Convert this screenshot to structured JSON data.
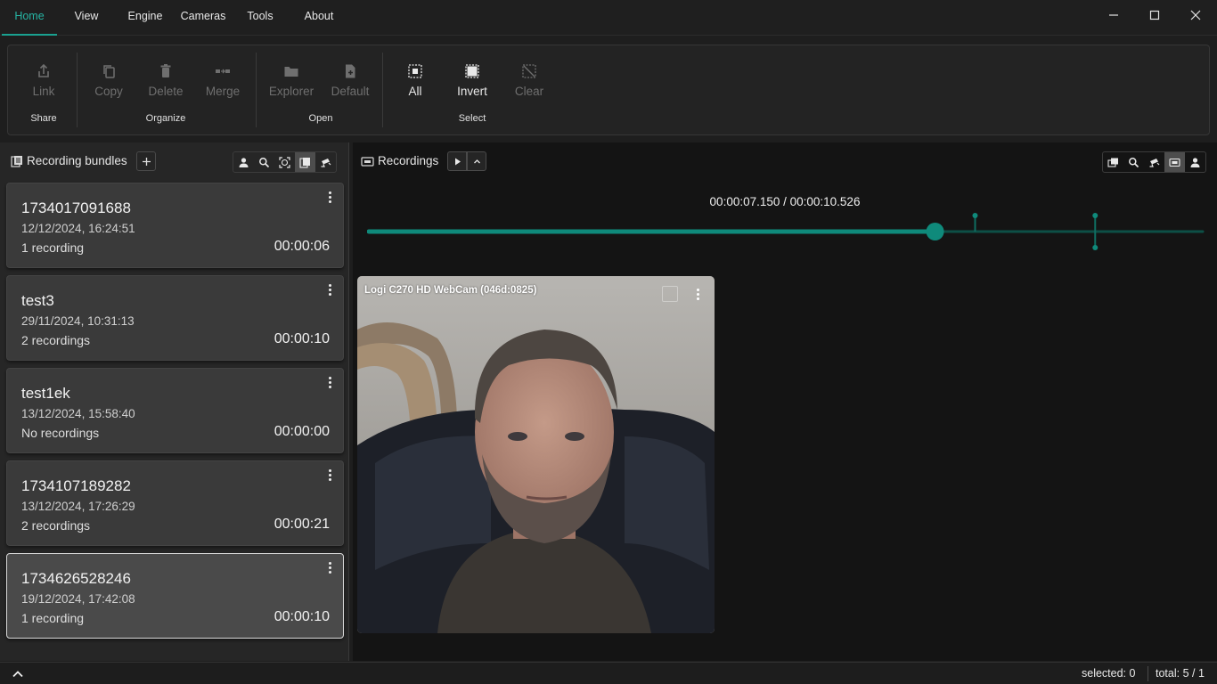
{
  "menu": {
    "items": [
      "Home",
      "View",
      "Engine",
      "Cameras",
      "Tools",
      "About"
    ],
    "active": "Home"
  },
  "window_controls": {
    "minimize": "—",
    "maximize": "☐",
    "close": "✕"
  },
  "ribbon": {
    "share": {
      "label": "Share",
      "link": "Link"
    },
    "organize": {
      "label": "Organize",
      "copy": "Copy",
      "delete": "Delete",
      "merge": "Merge"
    },
    "open": {
      "label": "Open",
      "explorer": "Explorer",
      "default": "Default"
    },
    "select": {
      "label": "Select",
      "all": "All",
      "invert": "Invert",
      "clear": "Clear"
    }
  },
  "bundles": {
    "title": "Recording bundles",
    "items": [
      {
        "name": "1734017091688",
        "date": "12/12/2024, 16:24:51",
        "count": "1 recording",
        "duration": "00:00:06"
      },
      {
        "name": "test3",
        "date": "29/11/2024, 10:31:13",
        "count": "2 recordings",
        "duration": "00:00:10"
      },
      {
        "name": "test1ek",
        "date": "13/12/2024, 15:58:40",
        "count": "No recordings",
        "duration": "00:00:00"
      },
      {
        "name": "1734107189282",
        "date": "13/12/2024, 17:26:29",
        "count": "2 recordings",
        "duration": "00:00:21"
      },
      {
        "name": "1734626528246",
        "date": "19/12/2024, 17:42:08",
        "count": "1 recording",
        "duration": "00:00:10",
        "selected": true
      }
    ]
  },
  "recordings": {
    "title": "Recordings",
    "timecode": "00:00:07.150 / 00:00:10.526",
    "progress": 0.679,
    "markers": [
      0.727,
      0.871
    ],
    "camera": {
      "label": "Logi C270 HD WebCam (046d:0825)"
    }
  },
  "status": {
    "selected": "selected: 0",
    "total": "total: 5 / 1"
  },
  "colors": {
    "accent": "#0f8a7b",
    "accent_dark": "#0d4f46",
    "background": "#1e1e1e"
  }
}
